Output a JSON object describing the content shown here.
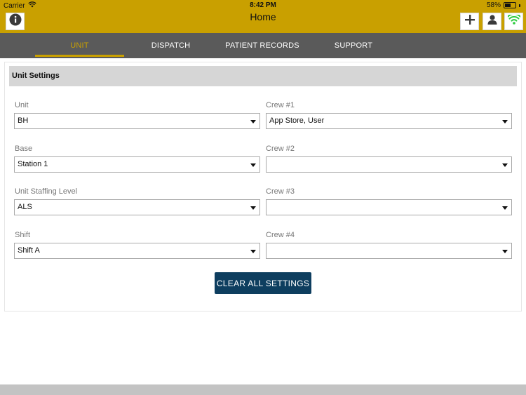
{
  "status_bar": {
    "carrier": "Carrier",
    "time": "8:42 PM",
    "battery_percent": "58%",
    "battery_level": 0.58
  },
  "header": {
    "title": "Home",
    "bg_color": "#c9a000",
    "buttons": [
      {
        "name": "info",
        "icon": "info-icon"
      },
      {
        "name": "add",
        "icon": "plus-icon"
      },
      {
        "name": "user",
        "icon": "user-icon"
      },
      {
        "name": "connection",
        "icon": "wifi-icon",
        "color": "#2ecc40"
      }
    ]
  },
  "tabs": [
    {
      "label": "UNIT",
      "active": true
    },
    {
      "label": "DISPATCH",
      "active": false
    },
    {
      "label": "PATIENT RECORDS",
      "active": false
    },
    {
      "label": "SUPPORT",
      "active": false
    }
  ],
  "unit_settings": {
    "title": "Unit Settings",
    "left_fields": [
      {
        "label": "Unit",
        "value": "BH"
      },
      {
        "label": "Base",
        "value": "Station 1"
      },
      {
        "label": "Unit Staffing Level",
        "value": "ALS"
      },
      {
        "label": "Shift",
        "value": "Shift A"
      }
    ],
    "right_fields": [
      {
        "label": "Crew #1",
        "value": "App Store, User"
      },
      {
        "label": "Crew #2",
        "value": ""
      },
      {
        "label": "Crew #3",
        "value": ""
      },
      {
        "label": "Crew #4",
        "value": ""
      }
    ],
    "clear_button": "CLEAR ALL SETTINGS",
    "clear_button_color": "#0e3e5f"
  }
}
